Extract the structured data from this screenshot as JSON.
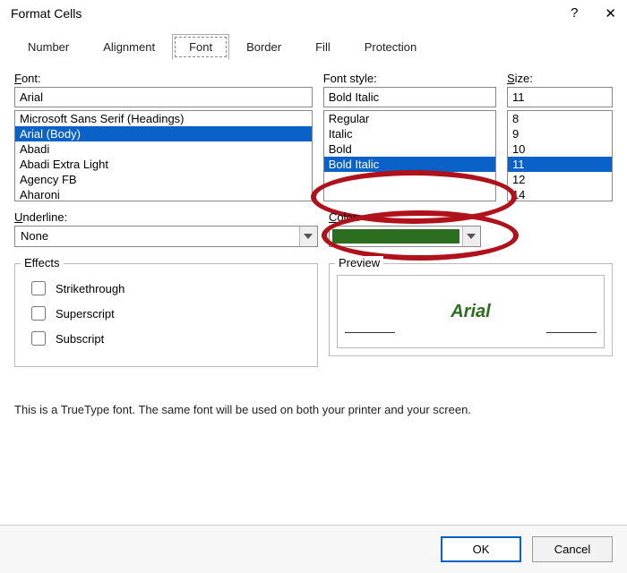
{
  "titlebar": {
    "title": "Format Cells",
    "help": "?",
    "close": "✕"
  },
  "tabs": [
    {
      "label": "Number"
    },
    {
      "label": "Alignment"
    },
    {
      "label": "Font",
      "active": true
    },
    {
      "label": "Border"
    },
    {
      "label": "Fill"
    },
    {
      "label": "Protection"
    }
  ],
  "font": {
    "label": "Font:",
    "value": "Arial",
    "items": [
      "Microsoft Sans Serif (Headings)",
      "Arial (Body)",
      "Abadi",
      "Abadi Extra Light",
      "Agency FB",
      "Aharoni"
    ],
    "selected_index": 1
  },
  "font_style": {
    "label": "Font style:",
    "value": "Bold Italic",
    "items": [
      "Regular",
      "Italic",
      "Bold",
      "Bold Italic"
    ],
    "selected_index": 3
  },
  "size": {
    "label": "Size:",
    "value": "11",
    "items": [
      "8",
      "9",
      "10",
      "11",
      "12",
      "14"
    ],
    "selected_index": 3
  },
  "underline": {
    "label": "Underline:",
    "value": "None"
  },
  "color": {
    "label": "Color:",
    "value_hex": "#2c6e1f"
  },
  "effects": {
    "legend": "Effects",
    "strikethrough": "Strikethrough",
    "superscript": "Superscript",
    "subscript": "Subscript"
  },
  "preview": {
    "legend": "Preview",
    "sample": "Arial"
  },
  "footnote": "This is a TrueType font.  The same font will be used on both your printer and your screen.",
  "buttons": {
    "ok": "OK",
    "cancel": "Cancel"
  }
}
